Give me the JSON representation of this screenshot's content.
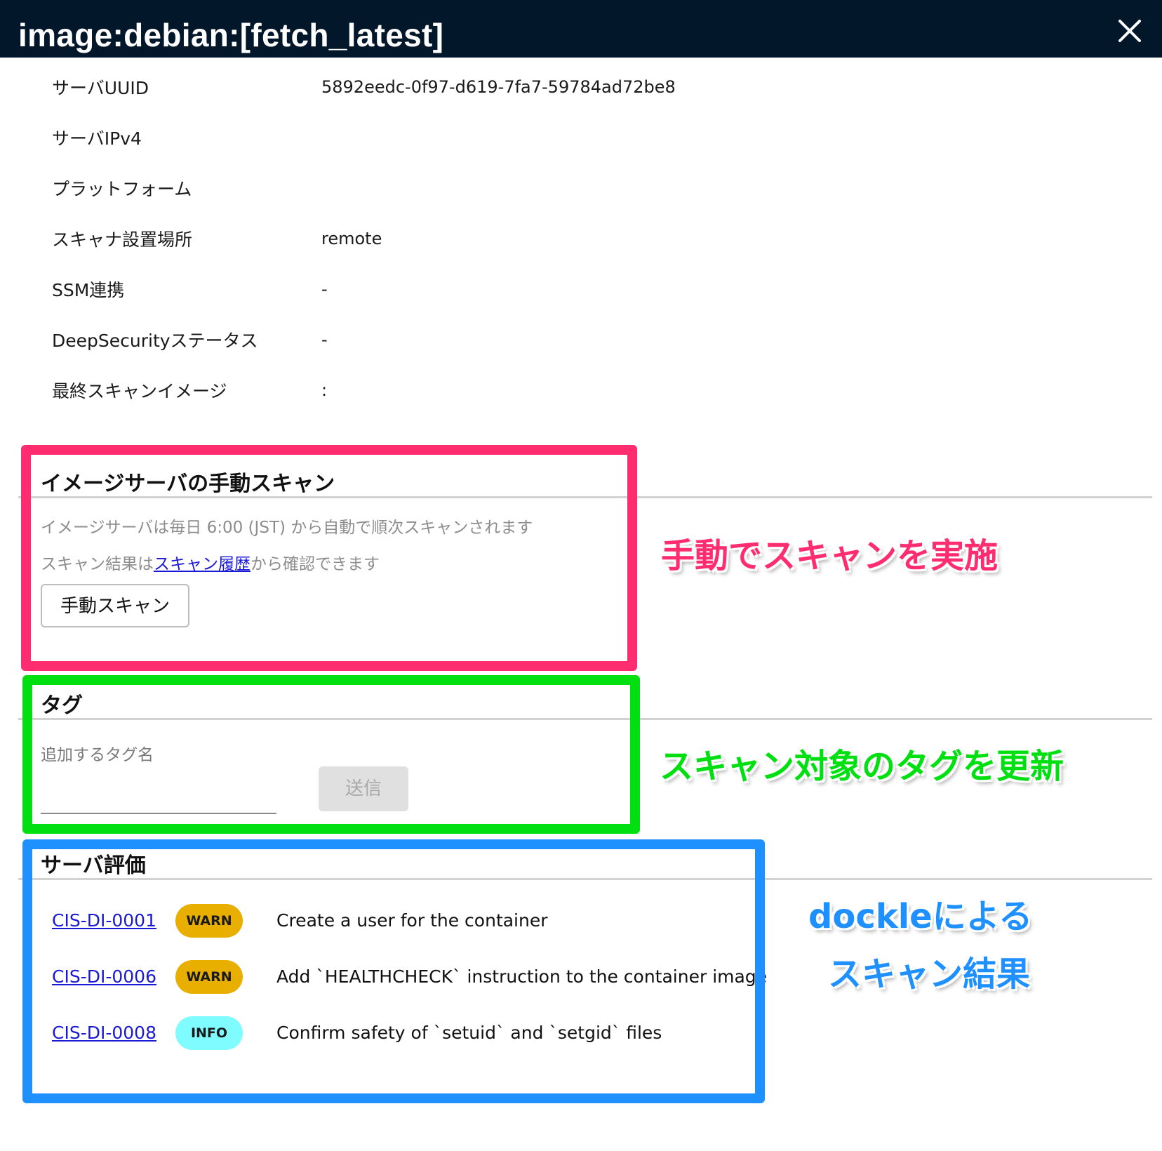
{
  "window": {
    "title": "image:debian:[fetch_latest]"
  },
  "info": [
    {
      "label": "サーバUUID",
      "value": "5892eedc-0f97-d619-7fa7-59784ad72be8"
    },
    {
      "label": "サーバIPv4",
      "value": ""
    },
    {
      "label": "プラットフォーム",
      "value": ""
    },
    {
      "label": "スキャナ設置場所",
      "value": "remote"
    },
    {
      "label": "SSM連携",
      "value": "-"
    },
    {
      "label": "DeepSecurityステータス",
      "value": "-"
    },
    {
      "label": "最終スキャンイメージ",
      "value": ":"
    }
  ],
  "manual_scan": {
    "heading": "イメージサーバの手動スキャン",
    "note1": "イメージサーバは毎日 6:00 (JST) から自動で順次スキャンされます",
    "note2_prefix": "スキャン結果は",
    "note2_link": "スキャン履歴",
    "note2_suffix": "から確認できます",
    "button_label": "手動スキャン"
  },
  "tags": {
    "heading": "タグ",
    "field_label": "追加するタグ名",
    "input_value": "",
    "submit_label": "送信"
  },
  "evaluation": {
    "heading": "サーバ評価",
    "items": [
      {
        "id": "CIS-DI-0001",
        "level": "WARN",
        "description": "Create a user for the container"
      },
      {
        "id": "CIS-DI-0006",
        "level": "WARN",
        "description": "Add `HEALTHCHECK` instruction to the container image"
      },
      {
        "id": "CIS-DI-0008",
        "level": "INFO",
        "description": "Confirm safety of `setuid` and `setgid` files"
      }
    ]
  },
  "annotations": {
    "manual_scan": "手動でスキャンを実施",
    "tags": "スキャン対象のタグを更新",
    "eval_line1": "dockleによる",
    "eval_line2": "スキャン結果"
  },
  "colors": {
    "titlebar": "#03172b",
    "annotation_pink": "#ff2d6f",
    "annotation_green": "#00e010",
    "annotation_blue": "#1e90ff",
    "warn_badge": "#e8ae00",
    "info_badge": "#7ffcff",
    "link": "#1a1ad6"
  },
  "icons": {
    "close": "close-icon"
  }
}
